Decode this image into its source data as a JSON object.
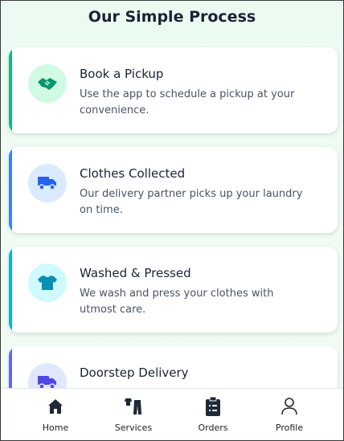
{
  "page_title": "Our Simple Process",
  "steps": [
    {
      "title": "Book a Pickup",
      "description": "Use the app to schedule a pickup at your convenience.",
      "icon": "handshake-icon",
      "accent": "#10b981",
      "icon_bg": "#d1fae5",
      "icon_color": "#059669"
    },
    {
      "title": "Clothes Collected",
      "description": "Our delivery partner picks up your laundry on time.",
      "icon": "truck-icon",
      "accent": "#3b82f6",
      "icon_bg": "#dbeafe",
      "icon_color": "#2563eb"
    },
    {
      "title": "Washed & Pressed",
      "description": "We wash and press your clothes with utmost care.",
      "icon": "shirt-icon",
      "accent": "#06b6d4",
      "icon_bg": "#cffafe",
      "icon_color": "#0891b2"
    },
    {
      "title": "Doorstep Delivery",
      "description": "",
      "icon": "delivery-truck-icon",
      "accent": "#6366f1",
      "icon_bg": "#e0e7ff",
      "icon_color": "#4f46e5"
    }
  ],
  "nav": {
    "items": [
      {
        "label": "Home",
        "icon": "home-icon"
      },
      {
        "label": "Services",
        "icon": "services-icon"
      },
      {
        "label": "Orders",
        "icon": "clipboard-icon"
      },
      {
        "label": "Profile",
        "icon": "user-icon"
      }
    ]
  }
}
